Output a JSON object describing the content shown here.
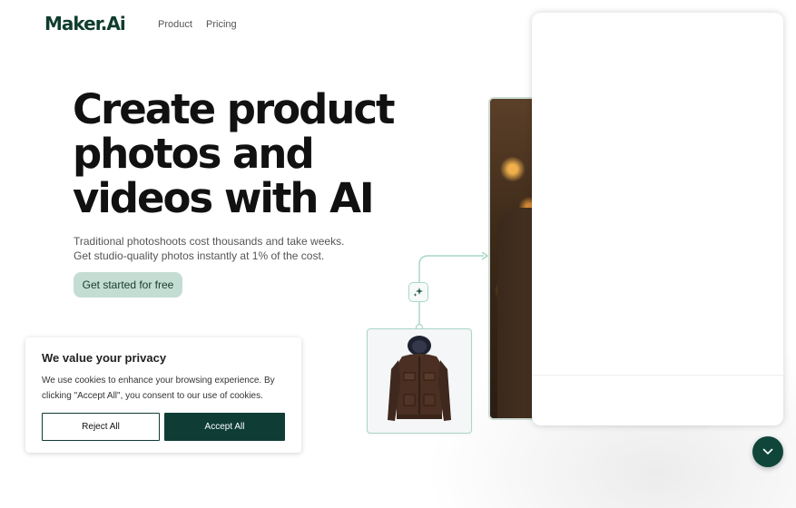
{
  "header": {
    "logo": "Maker.Ai",
    "nav": [
      "Product",
      "Pricing"
    ]
  },
  "hero": {
    "title": "Create product photos and videos with AI",
    "subtitle_lines": [
      "Traditional photoshoots cost thousands and take weeks.",
      "Get studio-quality photos instantly at 1% of the cost."
    ],
    "cta_label": "Get started for free"
  },
  "cookie_banner": {
    "title": "We value your privacy",
    "text": "We use cookies to enhance your browsing experience. By clicking \"Accept All\", you consent to our use of cookies.",
    "reject_label": "Reject All",
    "accept_label": "Accept All"
  },
  "icons": {
    "sparkle": "sparkle-icon",
    "chat": "chevron-down-icon"
  },
  "colors": {
    "brand": "#0f3d2e",
    "cta_bg": "#c4ddd3",
    "accent_line": "#a9d7c6",
    "accept_bg": "#0f3d36",
    "chat_bg": "#10463a"
  }
}
